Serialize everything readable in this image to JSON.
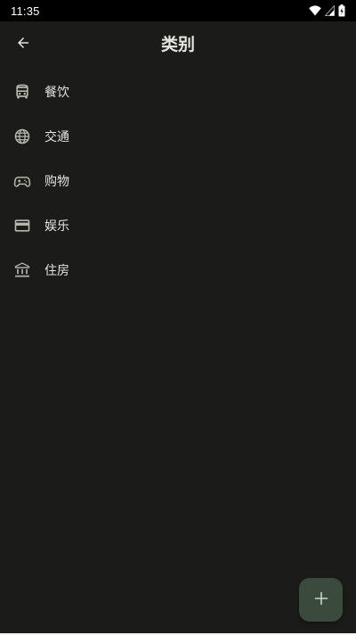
{
  "status_bar": {
    "time": "11:35"
  },
  "app_bar": {
    "title": "类别",
    "back_icon": "arrow-back-icon"
  },
  "categories": [
    {
      "label": "餐饮",
      "icon": "bus-icon"
    },
    {
      "label": "交通",
      "icon": "globe-icon"
    },
    {
      "label": "购物",
      "icon": "gamepad-icon"
    },
    {
      "label": "娱乐",
      "icon": "credit-card-icon"
    },
    {
      "label": "住房",
      "icon": "bank-icon"
    }
  ],
  "fab": {
    "icon": "plus-icon"
  },
  "colors": {
    "background": "#1b1c1a",
    "text": "#e4e3de",
    "icon": "#b5b7ae",
    "fab_background": "#3a4a3c",
    "fab_icon": "#c9d6c6"
  }
}
